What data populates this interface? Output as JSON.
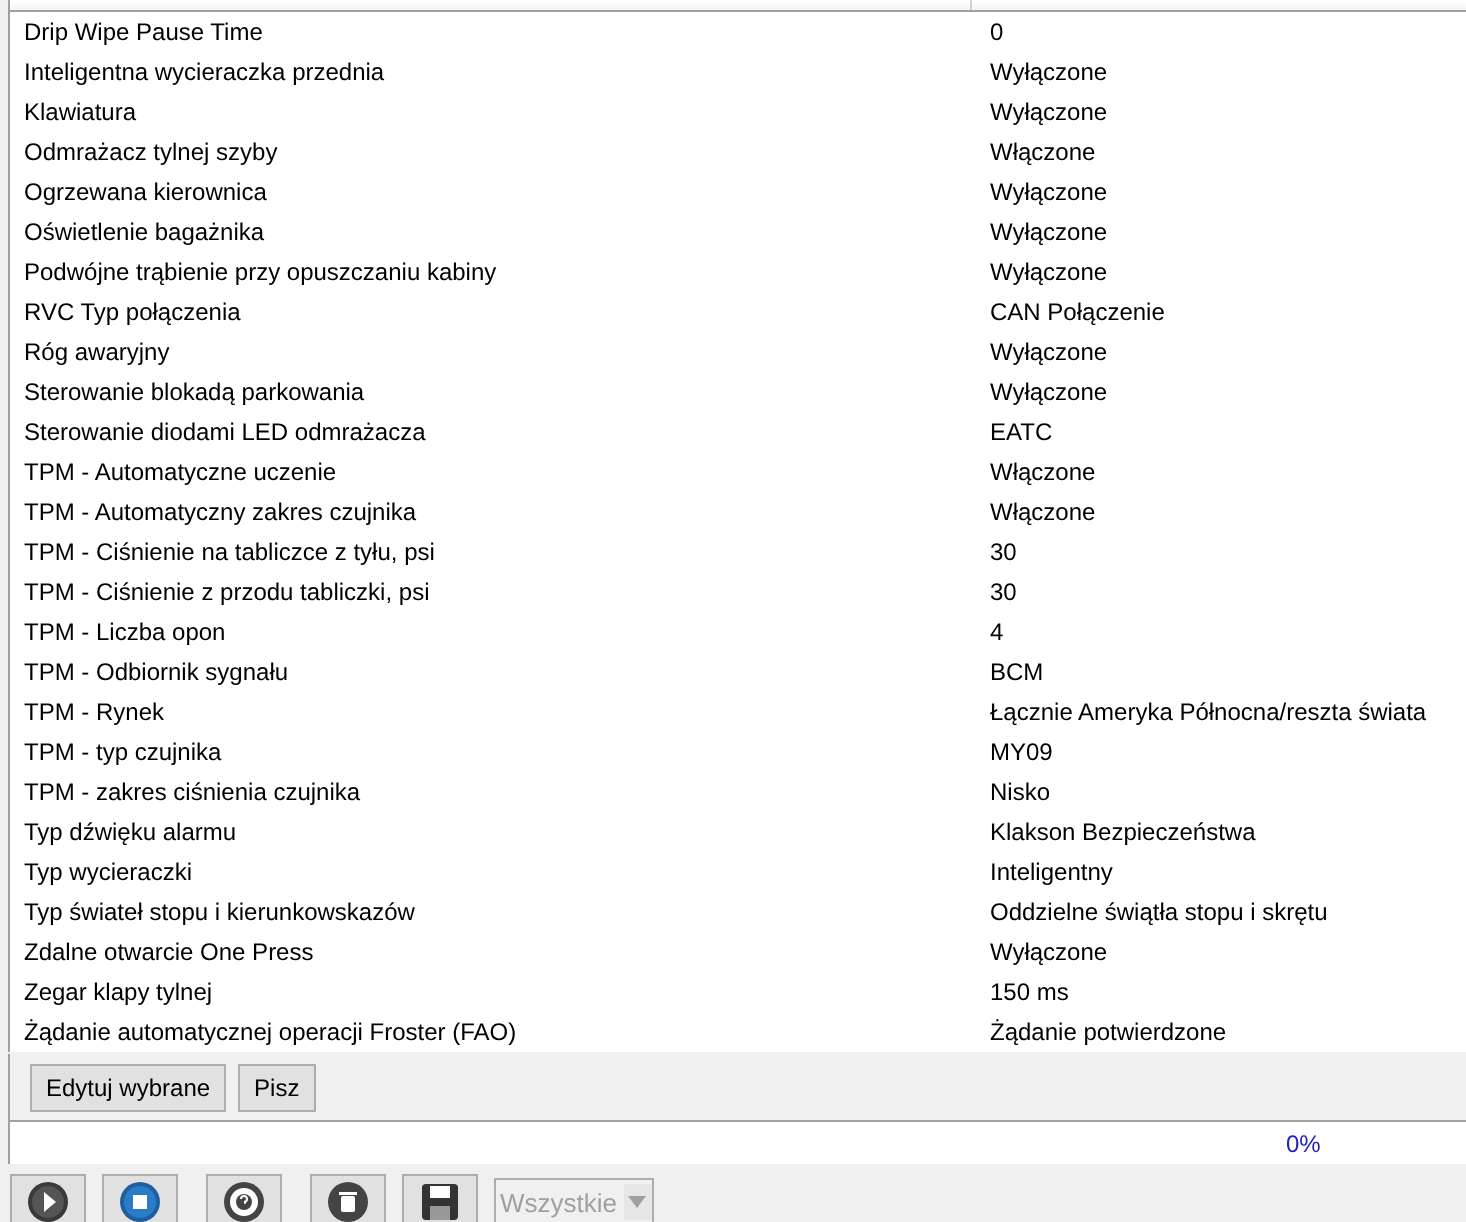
{
  "table": {
    "rows": [
      {
        "name": "Drip Wipe Pause Time",
        "value": "0"
      },
      {
        "name": "Inteligentna wycieraczka przednia",
        "value": "Wyłączone"
      },
      {
        "name": "Klawiatura",
        "value": "Wyłączone"
      },
      {
        "name": "Odmrażacz tylnej szyby",
        "value": "Włączone"
      },
      {
        "name": "Ogrzewana kierownica",
        "value": "Wyłączone"
      },
      {
        "name": "Oświetlenie bagażnika",
        "value": "Wyłączone"
      },
      {
        "name": "Podwójne trąbienie przy opuszczaniu kabiny",
        "value": "Wyłączone"
      },
      {
        "name": "RVC Typ połączenia",
        "value": "CAN Połączenie"
      },
      {
        "name": "Róg awaryjny",
        "value": "Wyłączone"
      },
      {
        "name": "Sterowanie blokadą parkowania",
        "value": "Wyłączone"
      },
      {
        "name": "Sterowanie diodami LED odmrażacza",
        "value": "EATC"
      },
      {
        "name": "TPM - Automatyczne uczenie",
        "value": "Włączone"
      },
      {
        "name": "TPM - Automatyczny zakres czujnika",
        "value": "Włączone"
      },
      {
        "name": "TPM - Ciśnienie na tabliczce z tyłu, psi",
        "value": "30"
      },
      {
        "name": "TPM - Ciśnienie z przodu tabliczki, psi",
        "value": "30"
      },
      {
        "name": "TPM - Liczba opon",
        "value": "4"
      },
      {
        "name": "TPM - Odbiornik sygnału",
        "value": "BCM"
      },
      {
        "name": "TPM - Rynek",
        "value": "Łącznie Ameryka Północna/reszta świata"
      },
      {
        "name": "TPM - typ czujnika",
        "value": "MY09"
      },
      {
        "name": "TPM - zakres ciśnienia czujnika",
        "value": "Nisko"
      },
      {
        "name": "Typ dźwięku alarmu",
        "value": "Klakson Bezpieczeństwa"
      },
      {
        "name": "Typ wycieraczki",
        "value": "Inteligentny"
      },
      {
        "name": "Typ świateł stopu i kierunkowskazów",
        "value": "Oddzielne świątła stopu i skrętu"
      },
      {
        "name": "Zdalne otwarcie One Press",
        "value": "Wyłączone"
      },
      {
        "name": "Zegar klapy tylnej",
        "value": "150 ms"
      },
      {
        "name": "Żądanie automatycznej operacji Froster (FAO)",
        "value": "Żądanie potwierdzone"
      }
    ]
  },
  "buttons": [
    "Edytuj wybrane",
    "Pisz"
  ],
  "progress": {
    "level": 0,
    "reading": "0%"
  },
  "toolbar": {
    "tools": [
      {
        "kind": "play"
      },
      {
        "kind": "stop"
      },
      {
        "kind": "help"
      },
      {
        "kind": "delete"
      },
      {
        "kind": "save"
      }
    ],
    "filter": {
      "value": "Wszystkie",
      "disabled": true
    }
  }
}
